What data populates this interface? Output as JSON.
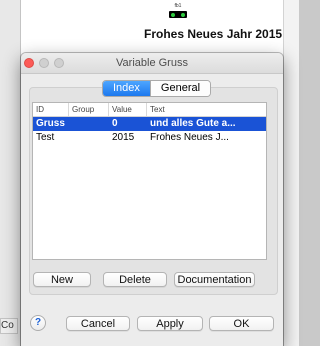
{
  "background": {
    "function_block_label": "fb1",
    "document_title": "Frohes Neues Jahr 2015",
    "bottom_left_text": "Co"
  },
  "dialog": {
    "title": "Variable Gruss",
    "tabs": [
      {
        "label": "Index",
        "active": true
      },
      {
        "label": "General",
        "active": false
      }
    ],
    "table": {
      "headers": [
        "ID",
        "Group",
        "Value",
        "Text"
      ],
      "rows": [
        {
          "id": "Gruss",
          "group": "",
          "value": "0",
          "text": "und alles Gute a...",
          "selected": true
        },
        {
          "id": "Test",
          "group": "",
          "value": "2015",
          "text": "Frohes Neues J...",
          "selected": false
        }
      ]
    },
    "buttons": {
      "new": "New",
      "delete": "Delete",
      "documentation": "Documentation",
      "help": "?",
      "cancel": "Cancel",
      "apply": "Apply",
      "ok": "OK"
    }
  },
  "colors": {
    "selection": "#1a53d6",
    "tab_active": "#1c78ee",
    "close_button": "#fc5b57"
  }
}
